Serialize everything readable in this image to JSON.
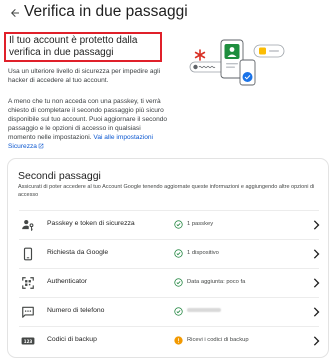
{
  "header": {
    "title": "Verifica in due passaggi",
    "back_icon": "arrow-back-icon"
  },
  "intro": {
    "title": "Il tuo account è protetto dalla verifica in due passaggi",
    "para1": "Usa un ulteriore livello di sicurezza per impedire agli hacker di accedere al tuo account.",
    "para2": "A meno che tu non acceda con una passkey, ti verrà chiesto di completare il secondo passaggio più sicuro disponibile sul tuo account. Puoi aggiornare il secondo passaggio e le opzioni di accesso in qualsiasi momento nelle impostazioni.",
    "link": "Vai alle impostazioni Sicurezza",
    "highlight_color": "#e0202a"
  },
  "second_steps": {
    "title": "Secondi passaggi",
    "description": "Assicurati di poter accedere al tuo Account Google tenendo aggiornate queste informazioni e aggiungendo altre opzioni di accesso",
    "items": [
      {
        "label": "Passkey e token di sicurezza",
        "status": "1 passkey",
        "status_type": "ok",
        "icon": "passkey-icon"
      },
      {
        "label": "Richiesta da Google",
        "status": "1 dispositivo",
        "status_type": "ok",
        "icon": "phone-icon"
      },
      {
        "label": "Authenticator",
        "status": "Data aggiunta: poco fa",
        "status_type": "ok",
        "icon": "authenticator-icon"
      },
      {
        "label": "Numero di telefono",
        "status": "",
        "status_type": "ok-hidden",
        "icon": "sms-icon"
      },
      {
        "label": "Codici di backup",
        "status": "Ricevi i codici di backup",
        "status_type": "warning",
        "icon": "backup-codes-icon"
      }
    ]
  },
  "colors": {
    "ok": "#188038",
    "warning": "#f29900",
    "link": "#0b57d0",
    "accent_green": "#1e8e3e",
    "accent_red": "#d93025",
    "accent_yellow": "#fbbc04"
  }
}
